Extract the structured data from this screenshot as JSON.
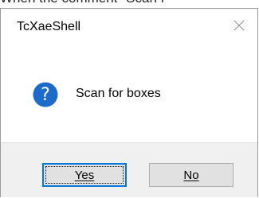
{
  "background_text": "When the comment \"Scan f",
  "dialog": {
    "title": "TcXaeShell",
    "close_icon": "close-icon",
    "message_icon": "question-icon",
    "message": "Scan for boxes",
    "buttons": {
      "yes_label": "Yes",
      "no_label": "No"
    }
  },
  "colors": {
    "icon_blue": "#1c6bc9",
    "focus_border": "#0078d7",
    "footer_bg": "#f0f0f0"
  }
}
